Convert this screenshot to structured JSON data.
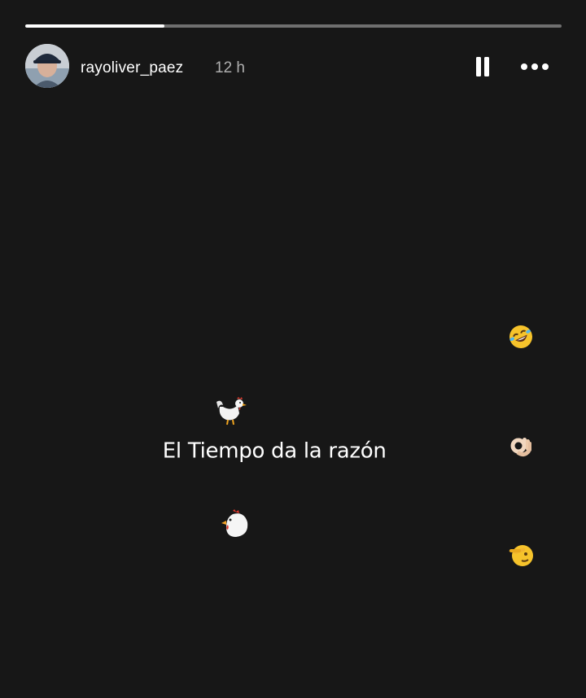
{
  "story": {
    "progress": 0.26,
    "colors": {
      "background": "#171717",
      "progress_fill": "#ffffff",
      "progress_track": "rgba(255,255,255,0.38)"
    }
  },
  "header": {
    "username": "rayoliver_paez",
    "time_ago": "12 h",
    "pause_icon": "pause-icon",
    "more_icon": "more-options-icon",
    "avatar_icon": "avatar"
  },
  "caption": {
    "line1_text": "El Tiempo da la razón",
    "line1_emojis": [
      "rolling-on-floor-laughing-emoji",
      "ok-hand-emoji",
      "saluting-face-emoji"
    ],
    "line2_emojis": [
      "rooster-emoji",
      "chicken-emoji"
    ]
  }
}
